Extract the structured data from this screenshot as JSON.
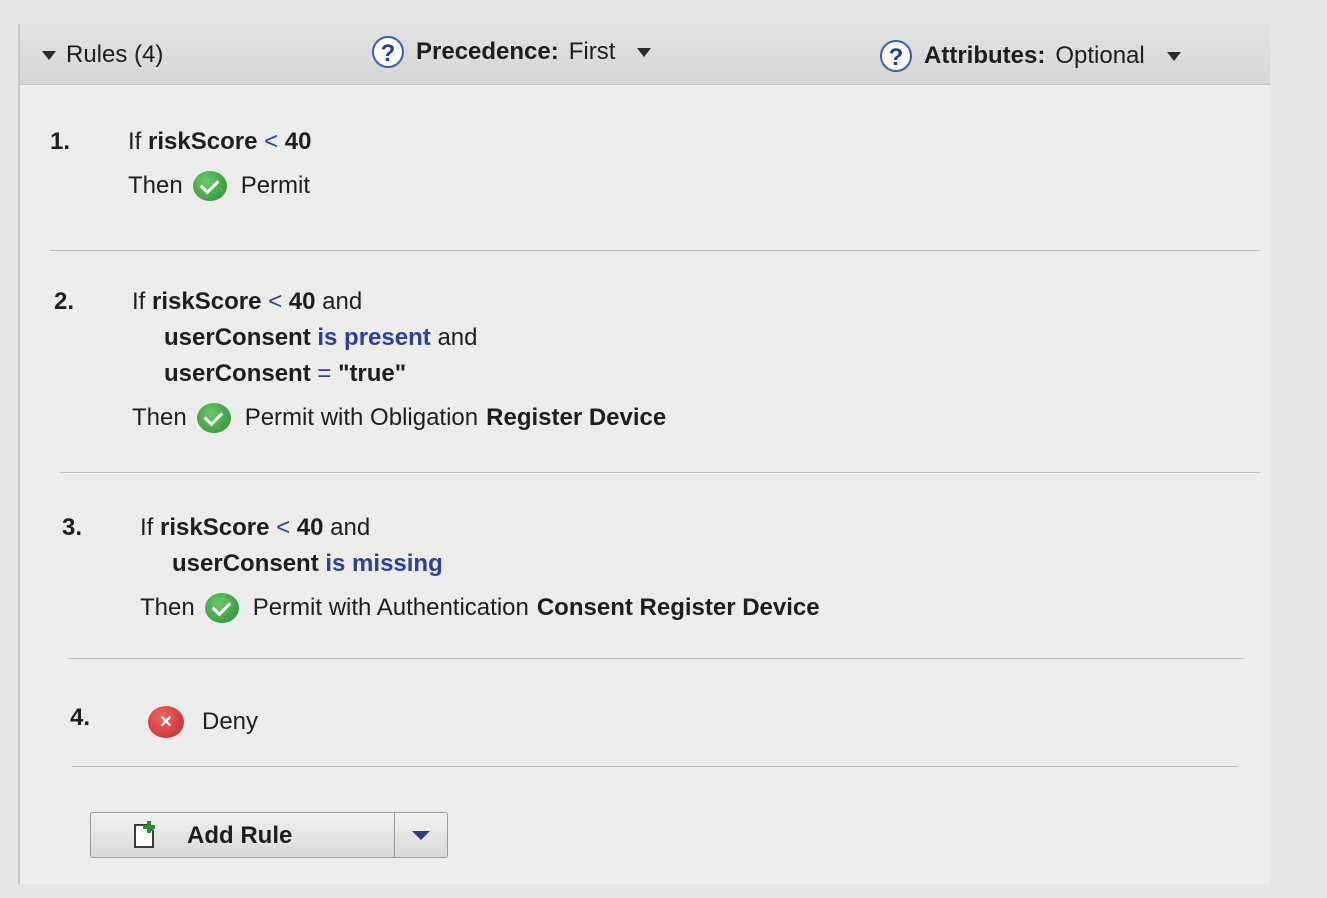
{
  "header": {
    "rules_label": "Rules (4)",
    "precedence_label": "Precedence:",
    "precedence_value": "First",
    "attributes_label": "Attributes:",
    "attributes_value": "Optional",
    "help_glyph": "?"
  },
  "rules": [
    {
      "number": "1.",
      "lines": [
        {
          "if": "If",
          "attr": "riskScore",
          "op": "<",
          "val": "40",
          "tail": ""
        }
      ],
      "then": "Then",
      "action": "Permit",
      "action_bold": ""
    },
    {
      "number": "2.",
      "lines": [
        {
          "if": "If",
          "attr": "riskScore",
          "op": "<",
          "val": "40",
          "tail": "and"
        },
        {
          "attr": "userConsent",
          "cond": "is present",
          "tail": "and"
        },
        {
          "attr": "userConsent",
          "op": "=",
          "val": "\"true\""
        }
      ],
      "then": "Then",
      "action": "Permit with Obligation",
      "action_bold": "Register Device"
    },
    {
      "number": "3.",
      "lines": [
        {
          "if": "If",
          "attr": "riskScore",
          "op": "<",
          "val": "40",
          "tail": "and"
        },
        {
          "attr": "userConsent",
          "cond": "is missing"
        }
      ],
      "then": "Then",
      "action": "Permit with Authentication",
      "action_bold": "Consent Register Device"
    },
    {
      "number": "4.",
      "action": "Deny",
      "deny_glyph": "×"
    }
  ],
  "add_rule": {
    "label": "Add Rule"
  },
  "icons": {
    "collapse": "triangle-down-icon",
    "help": "help-circle-icon",
    "permit": "check-circle-icon",
    "deny": "x-circle-icon",
    "add": "add-document-icon",
    "dropdown": "chevron-down-icon"
  },
  "colors": {
    "permit_green": "#2b8a2e",
    "deny_red": "#c22020",
    "condition_blue": "#2b3f9f",
    "help_blue": "#3a5faf"
  }
}
